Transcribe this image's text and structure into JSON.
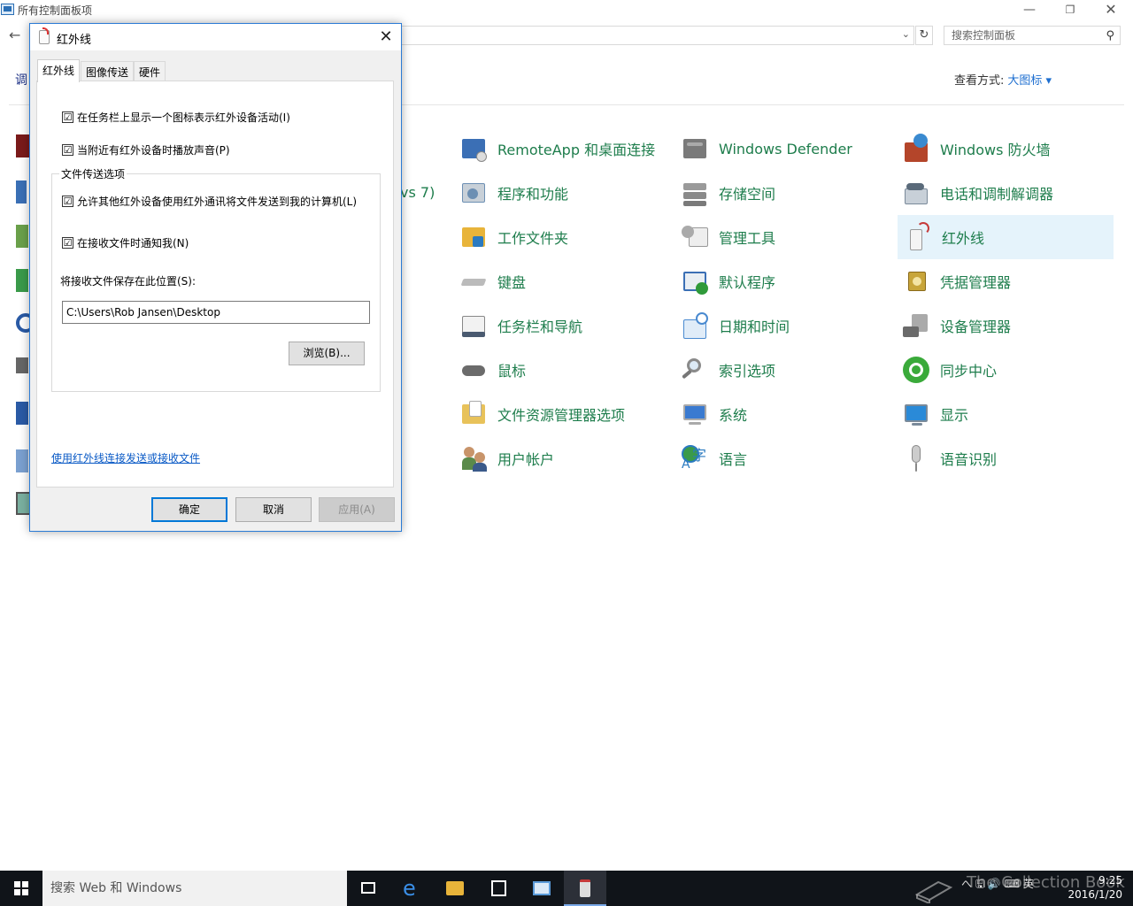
{
  "explorer": {
    "title": "所有控制面板项",
    "search_placeholder": "搜索控制面板",
    "view_by_label": "查看方式:",
    "view_by_value": "大图标 ▾",
    "left_partial": "调",
    "partial_item_text": "vs 7)"
  },
  "items": [
    {
      "label": "RemoteApp 和桌面连接",
      "icon": "remoteapp-icon",
      "color": "#3b6fb5"
    },
    {
      "label": "程序和功能",
      "icon": "programs-icon",
      "color": "#6c8fb3"
    },
    {
      "label": "工作文件夹",
      "icon": "work-folders-icon",
      "color": "#e8b43a"
    },
    {
      "label": "键盘",
      "icon": "keyboard-icon",
      "color": "#8a8a8a"
    },
    {
      "label": "任务栏和导航",
      "icon": "taskbar-nav-icon",
      "color": "#4a5a70"
    },
    {
      "label": "鼠标",
      "icon": "mouse-icon",
      "color": "#6b6b6b"
    },
    {
      "label": "文件资源管理器选项",
      "icon": "explorer-options-icon",
      "color": "#e8c25a"
    },
    {
      "label": "用户帐户",
      "icon": "user-accounts-icon",
      "color": "#5a8a4a"
    },
    {
      "label": "Windows Defender",
      "icon": "defender-icon",
      "color": "#7a7a7a"
    },
    {
      "label": "存储空间",
      "icon": "storage-icon",
      "color": "#8a8a8a"
    },
    {
      "label": "管理工具",
      "icon": "admin-tools-icon",
      "color": "#9a9a9a"
    },
    {
      "label": "默认程序",
      "icon": "default-programs-icon",
      "color": "#2f9a3a"
    },
    {
      "label": "日期和时间",
      "icon": "date-time-icon",
      "color": "#4a8ad0"
    },
    {
      "label": "索引选项",
      "icon": "indexing-icon",
      "color": "#8a8a8a"
    },
    {
      "label": "系统",
      "icon": "system-icon",
      "color": "#3a7ad0"
    },
    {
      "label": "语言",
      "icon": "language-icon",
      "color": "#2a7ac0"
    },
    {
      "label": "Windows 防火墙",
      "icon": "firewall-icon",
      "color": "#b4452a"
    },
    {
      "label": "电话和调制解调器",
      "icon": "phone-modem-icon",
      "color": "#7a8a9a"
    },
    {
      "label": "红外线",
      "icon": "infrared-icon",
      "color": "#c63a3a"
    },
    {
      "label": "凭据管理器",
      "icon": "credential-icon",
      "color": "#c8a53a"
    },
    {
      "label": "设备管理器",
      "icon": "device-manager-icon",
      "color": "#6a6a6a"
    },
    {
      "label": "同步中心",
      "icon": "sync-center-icon",
      "color": "#3aaa3a"
    },
    {
      "label": "显示",
      "icon": "display-icon",
      "color": "#2a8ad8"
    },
    {
      "label": "语音识别",
      "icon": "speech-icon",
      "color": "#8a8a8a"
    }
  ],
  "dialog": {
    "title": "红外线",
    "tabs": [
      "红外线",
      "图像传送",
      "硬件"
    ],
    "checks": [
      {
        "label": "在任务栏上显示一个图标表示红外设备活动(I)",
        "checked": "☑"
      },
      {
        "label": "当附近有红外设备时播放声音(P)",
        "checked": "☑"
      },
      {
        "label": "允许其他红外设备使用红外通讯将文件发送到我的计算机(L)",
        "checked": "☑"
      },
      {
        "label": "在接收文件时通知我(N)",
        "checked": "☑"
      }
    ],
    "group_label": "文件传送选项",
    "save_label": "将接收文件保存在此位置(S):",
    "save_path": "C:\\Users\\Rob Jansen\\Desktop",
    "browse": "浏览(B)...",
    "link": "使用红外线连接发送或接收文件",
    "ok": "确定",
    "cancel": "取消",
    "apply": "应用(A)"
  },
  "taskbar": {
    "search": "搜索 Web 和 Windows",
    "tray": "へ 🖫 🔊 ⌨ 英",
    "time": "9:25",
    "date": "2016/1/20",
    "watermark": "The Collection Book"
  }
}
